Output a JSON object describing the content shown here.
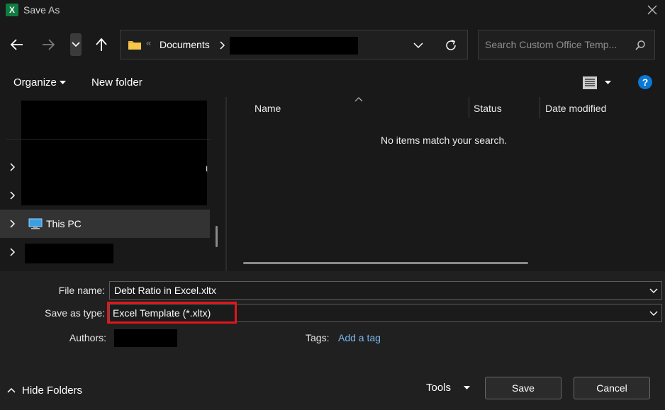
{
  "window": {
    "title": "Save As",
    "app_icon_letter": "X"
  },
  "address": {
    "folder": "Documents",
    "overflow": "«"
  },
  "search": {
    "placeholder": "Search Custom Office Temp..."
  },
  "toolbar": {
    "organize": "Organize",
    "new_folder": "New folder",
    "help": "?"
  },
  "nav_pane": {
    "this_pc": "This PC"
  },
  "file_list": {
    "columns": [
      "Name",
      "Status",
      "Date modified"
    ],
    "empty_message": "No items match your search."
  },
  "form": {
    "file_name_label": "File name:",
    "file_name_value": "Debt Ratio in Excel.xltx",
    "save_type_label": "Save as type:",
    "save_type_value": "Excel Template (*.xltx)",
    "authors_label": "Authors:",
    "tags_label": "Tags:",
    "tags_link": "Add a tag"
  },
  "footer": {
    "hide_folders": "Hide Folders",
    "tools": "Tools",
    "save": "Save",
    "cancel": "Cancel"
  },
  "colors": {
    "highlight": "#e0161b",
    "link": "#7ab6f0",
    "excel": "#107c41",
    "help": "#0a78d4"
  }
}
